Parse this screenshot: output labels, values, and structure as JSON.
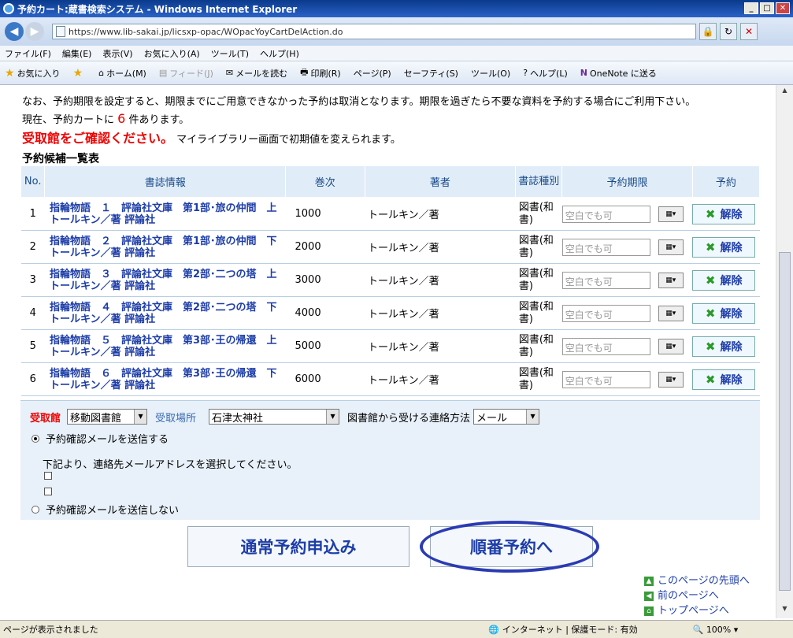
{
  "window": {
    "title": "予約カート:蔵書検索システム - Windows Internet Explorer"
  },
  "address": {
    "url": "https://www.lib-sakai.jp/licsxp-opac/WOpacYoyCartDelAction.do"
  },
  "menu": [
    "ファイル(F)",
    "編集(E)",
    "表示(V)",
    "お気に入り(A)",
    "ツール(T)",
    "ヘルプ(H)"
  ],
  "favbar": [
    "お気に入り",
    "ホーム(M)",
    "フィード(J)",
    "メールを読む",
    "印刷(R)",
    "ページ(P)",
    "セーフティ(S)",
    "ツール(O)",
    "ヘルプ(L)",
    "OneNote に送る"
  ],
  "page": {
    "note": "なお、予約期限を設定すると、期限までにご用意できなかった予約は取消となります。期限を過ぎたら不要な資料を予約する場合にご利用下さい。",
    "count_prefix": "現在、予約カートに",
    "count_num": "6",
    "count_suffix": "件あります。",
    "confirm_red": "受取館をご確認ください。",
    "confirm_rest": "マイライブラリー画面で初期値を変えられます。",
    "table_title": "予約候補一覧表"
  },
  "table": {
    "headers": [
      "No.",
      "書誌情報",
      "巻次",
      "著者",
      "書誌種別",
      "予約期限",
      "予約"
    ],
    "rows": [
      {
        "no": "1",
        "title": "指輪物語　１　評論社文庫　第1部･旅の仲間　上 トールキン／著 評論社",
        "vol": "1000",
        "author": "トールキン／著",
        "kind": "図書(和書)"
      },
      {
        "no": "2",
        "title": "指輪物語　２　評論社文庫　第1部･旅の仲間　下 トールキン／著 評論社",
        "vol": "2000",
        "author": "トールキン／著",
        "kind": "図書(和書)"
      },
      {
        "no": "3",
        "title": "指輪物語　３　評論社文庫　第2部･二つの塔　上 トールキン／著 評論社",
        "vol": "3000",
        "author": "トールキン／著",
        "kind": "図書(和書)"
      },
      {
        "no": "4",
        "title": "指輪物語　４　評論社文庫　第2部･二つの塔　下 トールキン／著 評論社",
        "vol": "4000",
        "author": "トールキン／著",
        "kind": "図書(和書)"
      },
      {
        "no": "5",
        "title": "指輪物語　５　評論社文庫　第3部･王の帰還　上 トールキン／著 評論社",
        "vol": "5000",
        "author": "トールキン／著",
        "kind": "図書(和書)"
      },
      {
        "no": "6",
        "title": "指輪物語　６　評論社文庫　第3部･王の帰還　下 トールキン／著 評論社",
        "vol": "6000",
        "author": "トールキン／著",
        "kind": "図書(和書)"
      }
    ],
    "date_placeholder": "空白でも可",
    "cancel_label": "解除"
  },
  "pickup": {
    "library_label": "受取館",
    "library_value": "移動図書館",
    "place_label": "受取場所",
    "place_value": "石津太神社",
    "contact_label": "図書館から受ける連絡方法",
    "contact_value": "メール",
    "send_mail": "予約確認メールを送信する",
    "choose_address": "下記より、連絡先メールアドレスを選択してください。",
    "no_mail": "予約確認メールを送信しない"
  },
  "buttons": {
    "normal": "通常予約申込み",
    "queue": "順番予約へ"
  },
  "links": [
    "このページの先頭へ",
    "前のページへ",
    "トップページへ"
  ],
  "status": {
    "text": "ページが表示されました",
    "zone": "インターネット | 保護モード: 有効",
    "zoom": "100%"
  }
}
